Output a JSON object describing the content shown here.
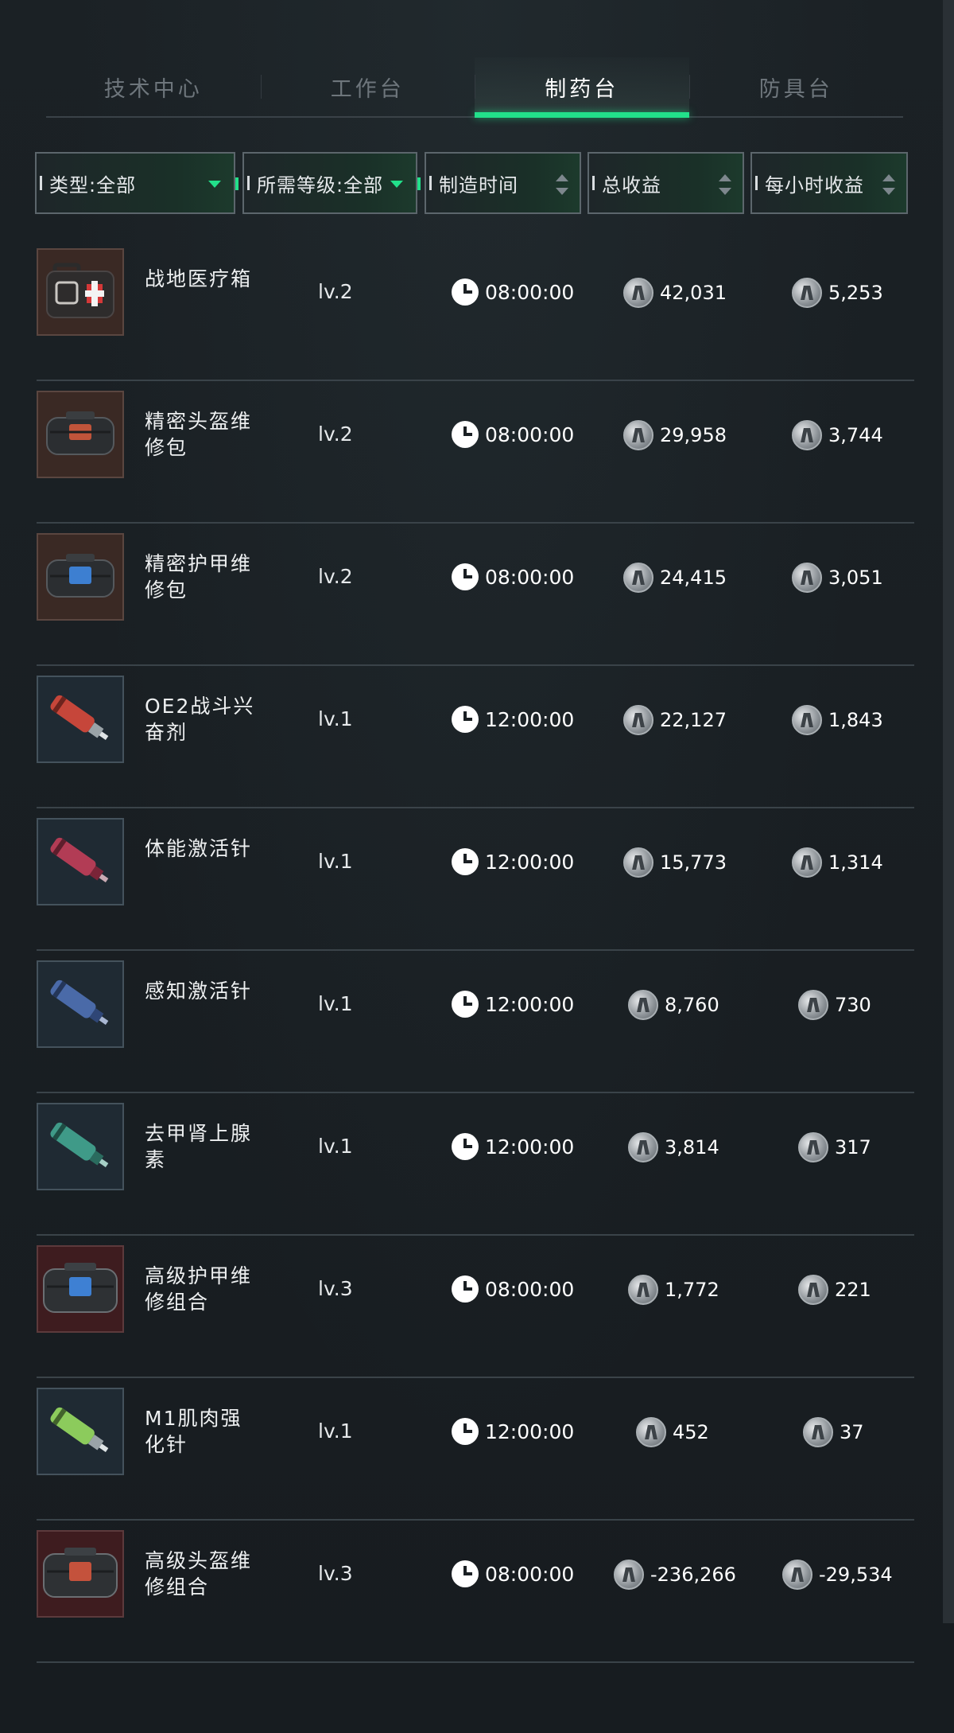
{
  "tabs": [
    {
      "label": "技术中心",
      "active": false
    },
    {
      "label": "工作台",
      "active": false
    },
    {
      "label": "制药台",
      "active": true
    },
    {
      "label": "防具台",
      "active": false
    }
  ],
  "filters": {
    "type": "类型:全部",
    "level": "所需等级:全部",
    "time": "制造时间",
    "total": "总收益",
    "hourly": "每小时收益"
  },
  "colors": {
    "accent": "#22e08a",
    "background": "#181d21"
  },
  "items": [
    {
      "name": "战地医疗箱",
      "icon": "medical-box-icon",
      "level": "lv.2",
      "time": "08:00:00",
      "total": "42,031",
      "hourly": "5,253"
    },
    {
      "name": "精密头盔维修包",
      "icon": "helmet-repair-kit-icon",
      "level": "lv.2",
      "time": "08:00:00",
      "total": "29,958",
      "hourly": "3,744"
    },
    {
      "name": "精密护甲维修包",
      "icon": "armor-repair-kit-icon",
      "level": "lv.2",
      "time": "08:00:00",
      "total": "24,415",
      "hourly": "3,051"
    },
    {
      "name": "OE2战斗兴奋剂",
      "icon": "red-injector-icon",
      "level": "lv.1",
      "time": "12:00:00",
      "total": "22,127",
      "hourly": "1,843"
    },
    {
      "name": "体能激活针",
      "icon": "pink-injector-icon",
      "level": "lv.1",
      "time": "12:00:00",
      "total": "15,773",
      "hourly": "1,314"
    },
    {
      "name": "感知激活针",
      "icon": "blue-injector-icon",
      "level": "lv.1",
      "time": "12:00:00",
      "total": "8,760",
      "hourly": "730"
    },
    {
      "name": "去甲肾上腺素",
      "icon": "teal-injector-icon",
      "level": "lv.1",
      "time": "12:00:00",
      "total": "3,814",
      "hourly": "317"
    },
    {
      "name": "高级护甲维修组合",
      "icon": "advanced-armor-kit-icon",
      "level": "lv.3",
      "time": "08:00:00",
      "total": "1,772",
      "hourly": "221"
    },
    {
      "name": "M1肌肉强化针",
      "icon": "green-injector-icon",
      "level": "lv.1",
      "time": "12:00:00",
      "total": "452",
      "hourly": "37"
    },
    {
      "name": "高级头盔维修组合",
      "icon": "advanced-helmet-kit-icon",
      "level": "lv.3",
      "time": "08:00:00",
      "total": "-236,266",
      "hourly": "-29,534"
    }
  ]
}
